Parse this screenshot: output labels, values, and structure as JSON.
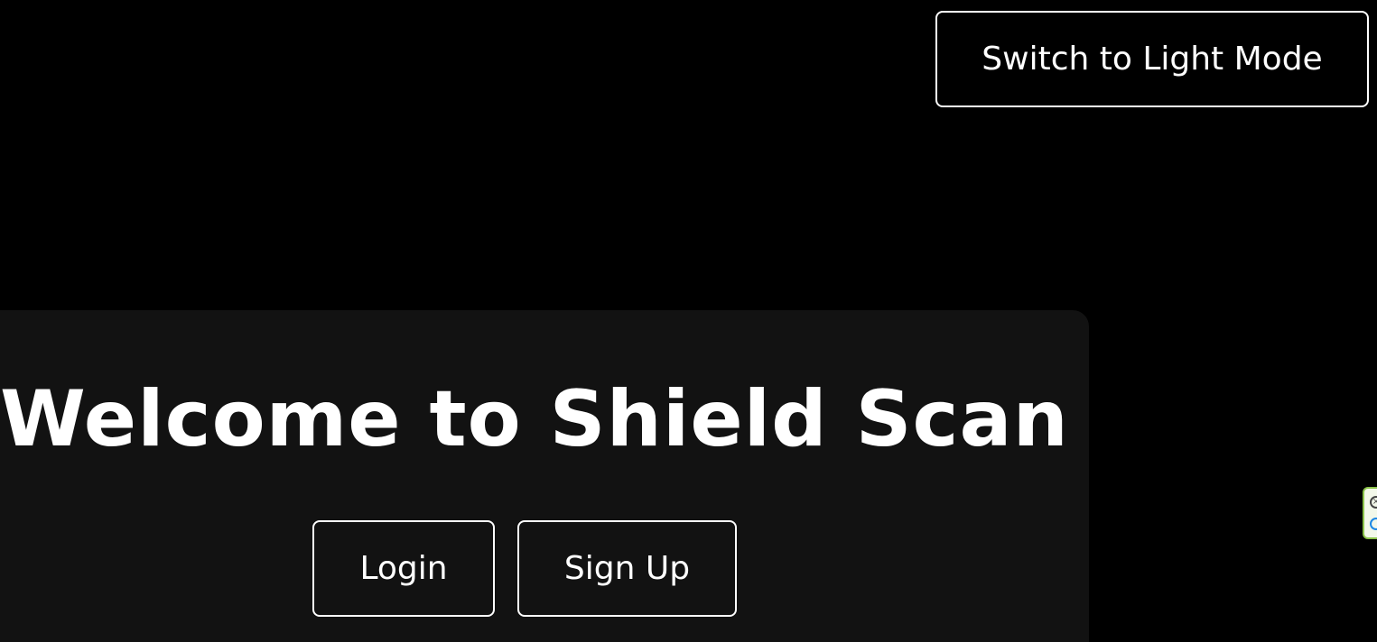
{
  "header": {
    "theme_toggle_label": "Switch to Light Mode"
  },
  "hero": {
    "title": "Welcome to Shield Scan",
    "login_label": "Login",
    "signup_label": "Sign Up"
  },
  "extension_widget": {
    "icons": [
      "close-icon",
      "extension-logo-icon"
    ],
    "border_color": "#8bc34a"
  },
  "colors": {
    "background": "#000000",
    "card": "#121212",
    "text": "#ffffff",
    "button_border": "#ffffff"
  }
}
